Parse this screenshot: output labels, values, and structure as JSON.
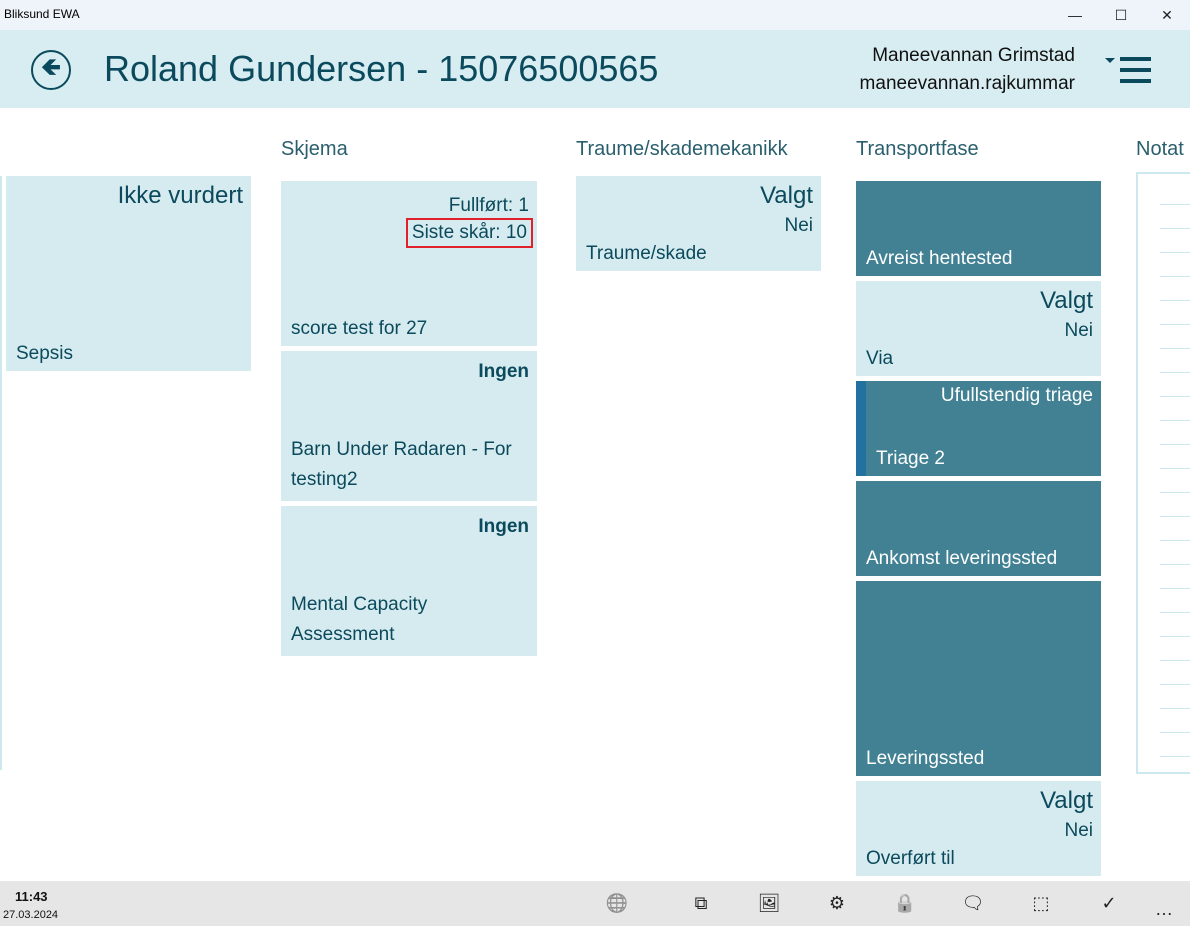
{
  "window": {
    "title": "Bliksund EWA"
  },
  "header": {
    "title": "Roland Gundersen - 15076500565",
    "user_name": "Maneevannan Grimstad",
    "user_login": "maneevannan.rajkummar"
  },
  "columns": {
    "left": {
      "status": "Ikke vurdert",
      "label": "Sepsis"
    },
    "skjema": {
      "heading": "Skjema",
      "items": [
        {
          "line1": "Fullført: 1",
          "line2": "Siste skår: 10",
          "label": "score test for 27"
        },
        {
          "status": "Ingen",
          "label": "Barn Under Radaren - For testing2"
        },
        {
          "status": "Ingen",
          "label": "Mental Capacity Assessment"
        }
      ]
    },
    "traume": {
      "heading": "Traume/skademekanikk",
      "status": "Valgt",
      "value": "Nei",
      "label": "Traume/skade"
    },
    "transport": {
      "heading": "Transportfase",
      "items": [
        {
          "label": "Avreist hentested"
        },
        {
          "status": "Valgt",
          "value": "Nei",
          "label": "Via"
        },
        {
          "status": "Ufullstendig triage",
          "label": "Triage 2"
        },
        {
          "label": "Ankomst leveringssted"
        },
        {
          "label": "Leveringssted"
        },
        {
          "status": "Valgt",
          "value": "Nei",
          "label": "Overført til"
        }
      ]
    },
    "notat": {
      "heading": "Notat"
    }
  },
  "statusbar": {
    "time": "11:43",
    "date": "27.03.2024"
  },
  "toolbar": [
    "globe-icon",
    "add-document-icon",
    "image-icon",
    "gear-icon",
    "lock-icon",
    "comment-icon",
    "crop-icon",
    "check-icon",
    "more-icon"
  ],
  "colors": {
    "header_bg": "#d7edf2",
    "tile_light": "#d6ebf0",
    "tile_dark": "#418193",
    "text": "#0b4a5c",
    "highlight": "#e0202a",
    "triage_stripe": "#2271a0"
  }
}
